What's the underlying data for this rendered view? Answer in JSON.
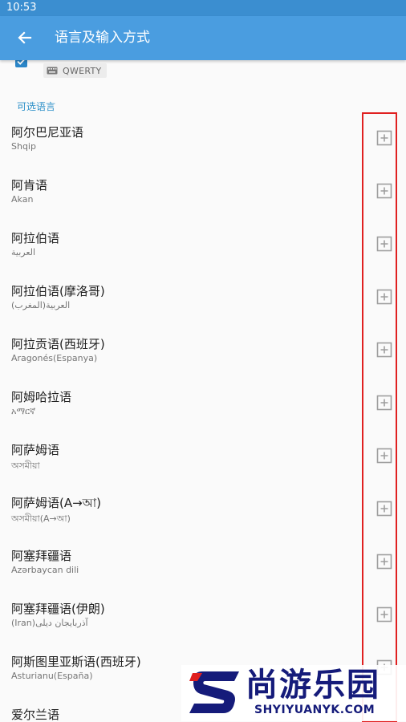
{
  "status_bar": {
    "time": "10:53"
  },
  "app_bar": {
    "title": "语言及输入方式",
    "back_icon": "arrow-left-icon"
  },
  "enabled_language": {
    "checked": true,
    "layout_label": "QWERTY",
    "layout_icon": "keyboard-icon"
  },
  "section_header": "可选语言",
  "languages": [
    {
      "name": "阿尔巴尼亚语",
      "native": "Shqip"
    },
    {
      "name": "阿肯语",
      "native": "Akan"
    },
    {
      "name": "阿拉伯语",
      "native": "العربية"
    },
    {
      "name": "阿拉伯语(摩洛哥)",
      "native": "العربية(المغرب)"
    },
    {
      "name": "阿拉贡语(西班牙)",
      "native": "Aragonés(Espanya)"
    },
    {
      "name": "阿姆哈拉语",
      "native": "አማርኛ"
    },
    {
      "name": "阿萨姆语",
      "native": "অসমীয়া"
    },
    {
      "name": "阿萨姆语(A→আ)",
      "native": "অসমীয়া(A→আ)"
    },
    {
      "name": "阿塞拜疆语",
      "native": "Azərbaycan dili"
    },
    {
      "name": "阿塞拜疆语(伊朗)",
      "native": "(Iran)آذربایجان دیلی"
    },
    {
      "name": "阿斯图里亚斯语(西班牙)",
      "native": "Asturianu(España)"
    },
    {
      "name": "爱尔兰语",
      "native": ""
    }
  ],
  "add_icon": "plus-square-icon",
  "watermark": {
    "text": "尚游乐园",
    "url": "SHYIYUANYK.COM"
  },
  "colors": {
    "app_bar": "#4a9de0",
    "status_bar": "#3b8ed0",
    "accent": "#2a86c8",
    "highlight": "#e02020"
  }
}
